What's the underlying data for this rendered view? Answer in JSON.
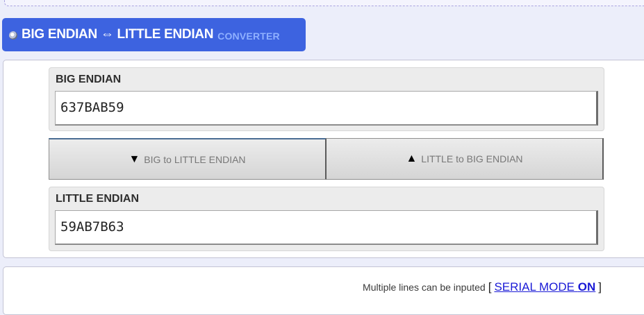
{
  "header": {
    "title": "BIG ENDIAN ⇔ LITTLE ENDIAN",
    "subtitle": "CONVERTER",
    "icon": "gear-ball-icon"
  },
  "big_endian": {
    "label": "BIG ENDIAN",
    "value": "637BAB59"
  },
  "buttons": {
    "big_to_little": {
      "arrow": "▼",
      "label": "BIG to LITTLE ENDIAN"
    },
    "little_to_big": {
      "arrow": "▲",
      "label": "LITTLE to BIG ENDIAN"
    }
  },
  "little_endian": {
    "label": "LITTLE ENDIAN",
    "value": "59AB7B63"
  },
  "serial": {
    "note": "Multiple lines can be inputed",
    "bracket_open": "[",
    "link_text": "SERIAL MODE",
    "state": "ON",
    "bracket_close": "]"
  },
  "colors": {
    "title_bg": "#3d63e0",
    "subtitle": "#8fb0ff",
    "link": "#1a1ad6",
    "page_bg": "#eceefa"
  }
}
